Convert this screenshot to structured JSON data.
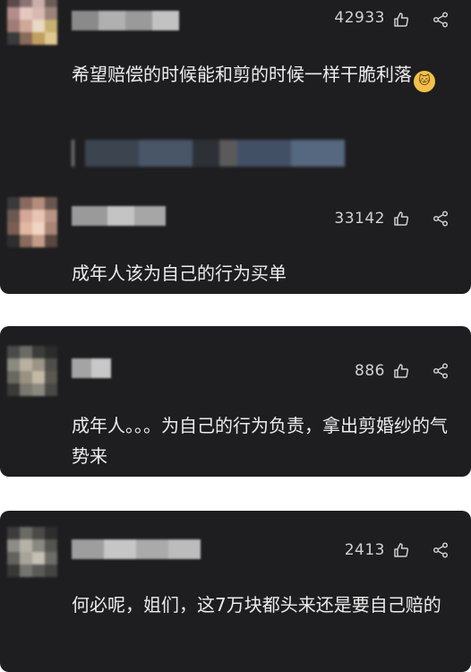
{
  "comments": [
    {
      "likes": "42933",
      "text": "希望赔偿的时候能和剪的时候一样干脆利落",
      "emoji": "🐱"
    },
    {
      "likes": "33142",
      "text": "成年人该为自己的行为买单"
    },
    {
      "likes": "886",
      "text": "成年人。。。为自己的行为负责，拿出剪婚纱的气势来"
    },
    {
      "likes": "2413",
      "text": "何必呢，姐们，这7万块都头来还是要自己赔的"
    }
  ],
  "icons": {
    "like": "thumbs-up-icon",
    "share": "share-icon"
  },
  "colors": {
    "card_bg": "#1e1e20",
    "text": "#ececec",
    "meta": "#d2d2d2",
    "page_bg": "#ffffff"
  }
}
